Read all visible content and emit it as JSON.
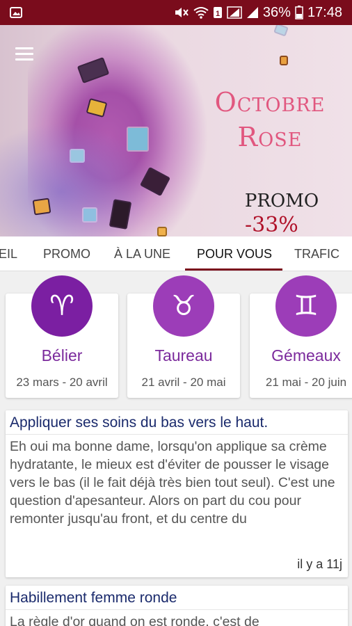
{
  "status_bar": {
    "battery": "36%",
    "time": "17:48",
    "icons": [
      "image-icon",
      "mute-icon",
      "wifi-icon",
      "data-icon",
      "signal-icon",
      "signal-icon-2",
      "battery-icon"
    ]
  },
  "banner": {
    "title_line1": "Octobre",
    "title_line2": "Rose",
    "promo": "PROMO",
    "discount": "-33%"
  },
  "tabs": [
    "EIL",
    "PROMO",
    "À LA UNE",
    "POUR VOUS",
    "TRAFIC"
  ],
  "active_tab": "POUR VOUS",
  "zodiac": [
    {
      "symbol": "♈",
      "name": "Bélier",
      "dates": "23 mars - 20 avril",
      "color": "#7b1fa2"
    },
    {
      "symbol": "♉",
      "name": "Taureau",
      "dates": "21 avril - 20 mai",
      "color": "#9c3db8"
    },
    {
      "symbol": "♊",
      "name": "Gémeaux",
      "dates": "21 mai - 20 juin",
      "color": "#9c3db8"
    }
  ],
  "articles": [
    {
      "title": "Appliquer ses soins du bas vers le haut.",
      "body": "Eh oui ma bonne dame, lorsqu'on applique sa crème hydratante, le mieux est d'éviter de pousser le visage vers le bas (il le fait déjà très bien tout seul). C'est une question d'apesanteur. Alors on part du cou pour remonter jusqu'au front, et du centre du",
      "time": "il y a 11j"
    },
    {
      "title": "Habillement femme ronde",
      "body": "La règle d'or quand on est ronde, c'est de",
      "time": ""
    }
  ]
}
